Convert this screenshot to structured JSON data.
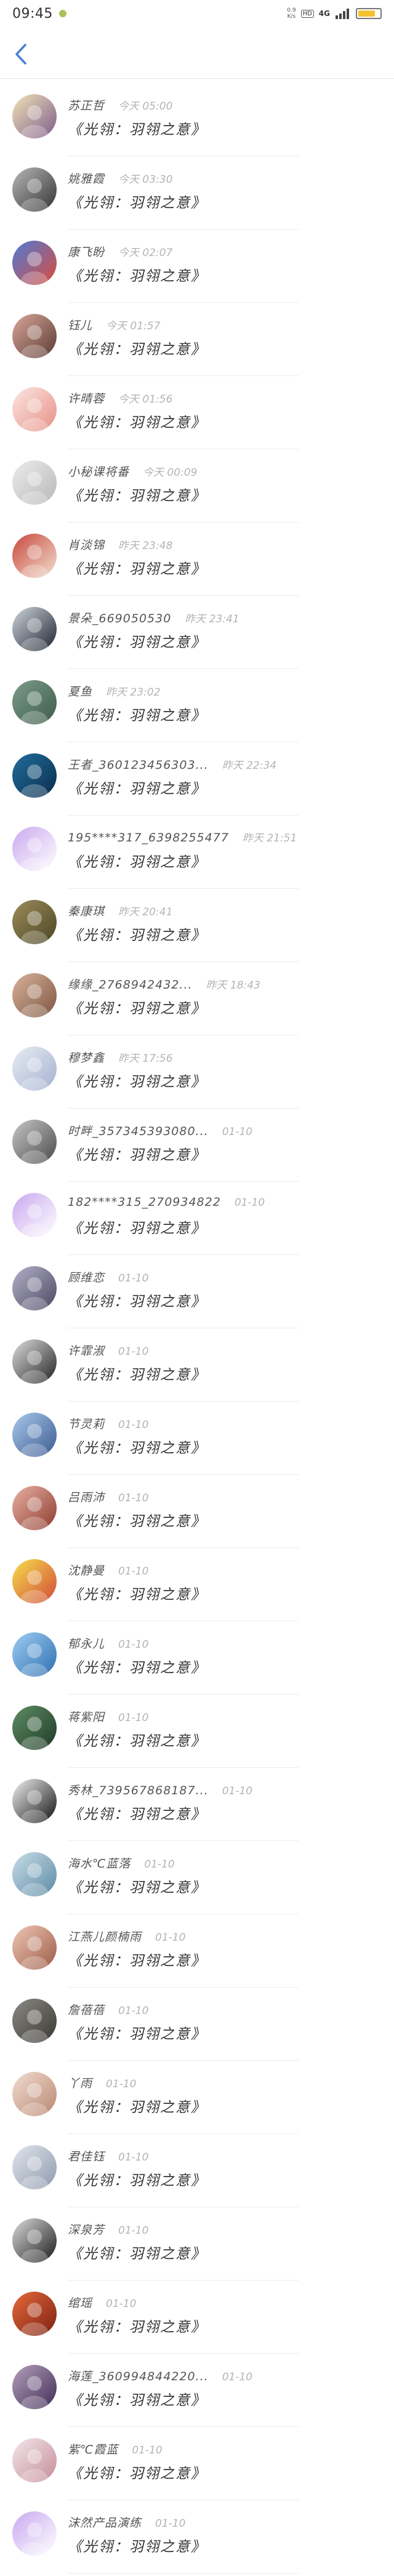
{
  "status_bar": {
    "time": "09:45",
    "net_speed_top": "0.9",
    "net_speed_unit": "K/s",
    "hd": "HD",
    "signal_label": "4G",
    "battery_color": "#f2c230",
    "battery_percent": 80
  },
  "header": {
    "back_icon": "chevron-left-icon",
    "accent": "#4a7fd4"
  },
  "conversations": [
    {
      "name": "苏正哲",
      "time": "今天 05:00",
      "message": "《光翎：羽翎之意》",
      "avatar": [
        "#f3e4b5",
        "#7d5a8c"
      ]
    },
    {
      "name": "姚雅霞",
      "time": "今天 03:30",
      "message": "《光翎：羽翎之意》",
      "avatar": [
        "#b8b8b8",
        "#333333"
      ]
    },
    {
      "name": "康飞盼",
      "time": "今天 02:07",
      "message": "《光翎：羽翎之意》",
      "avatar": [
        "#4f7bd6",
        "#d94c3c"
      ]
    },
    {
      "name": "钰儿",
      "time": "今天 01:57",
      "message": "《光翎：羽翎之意》",
      "avatar": [
        "#d9a79a",
        "#5a3a32"
      ]
    },
    {
      "name": "许晴蓉",
      "time": "今天 01:56",
      "message": "《光翎：羽翎之意》",
      "avatar": [
        "#fbe7e2",
        "#e78f86"
      ]
    },
    {
      "name": "小秘课将番",
      "time": "今天 00:09",
      "message": "《光翎：羽翎之意》",
      "avatar": [
        "#ececec",
        "#b8b8b8"
      ]
    },
    {
      "name": "肖淡锦",
      "time": "昨天 23:48",
      "message": "《光翎：羽翎之意》",
      "avatar": [
        "#c9473d",
        "#f1e0cf"
      ]
    },
    {
      "name": "景朵_669050530",
      "time": "昨天 23:41",
      "message": "《光翎：羽翎之意》",
      "avatar": [
        "#cfd6dd",
        "#1d2430"
      ]
    },
    {
      "name": "夏鱼",
      "time": "昨天 23:02",
      "message": "《光翎：羽翎之意》",
      "avatar": [
        "#7e9c8a",
        "#3c5b4a"
      ]
    },
    {
      "name": "王者_360123456303...",
      "time": "昨天 22:34",
      "message": "《光翎：羽翎之意》",
      "avatar": [
        "#1f6e9c",
        "#0c2c4d"
      ]
    },
    {
      "name": "195****317_6398255477",
      "time": "昨天 21:51",
      "message": "《光翎：羽翎之意》",
      "avatar": [
        "#c9a8ef",
        "#ffffff"
      ]
    },
    {
      "name": "秦康琪",
      "time": "昨天 20:41",
      "message": "《光翎：羽翎之意》",
      "avatar": [
        "#9b8d5a",
        "#4d4525"
      ]
    },
    {
      "name": "缘缘_2768942432...",
      "time": "昨天 18:43",
      "message": "《光翎：羽翎之意》",
      "avatar": [
        "#d9b49b",
        "#7d5442"
      ]
    },
    {
      "name": "穆梦鑫",
      "time": "昨天 17:56",
      "message": "《光翎：羽翎之意》",
      "avatar": [
        "#e8ecf4",
        "#a4b1cf"
      ]
    },
    {
      "name": "时畔_357345393080...",
      "time": "01-10",
      "message": "《光翎：羽翎之意》",
      "avatar": [
        "#c7c7c7",
        "#4a4a4a"
      ]
    },
    {
      "name": "182****315_270934822",
      "time": "01-10",
      "message": "《光翎：羽翎之意》",
      "avatar": [
        "#c9a8ef",
        "#ffffff"
      ]
    },
    {
      "name": "顾维恋",
      "time": "01-10",
      "message": "《光翎：羽翎之意》",
      "avatar": [
        "#b4b2c9",
        "#4b4762"
      ]
    },
    {
      "name": "许霏淑",
      "time": "01-10",
      "message": "《光翎：羽翎之意》",
      "avatar": [
        "#dedede",
        "#222222"
      ]
    },
    {
      "name": "节灵莉",
      "time": "01-10",
      "message": "《光翎：羽翎之意》",
      "avatar": [
        "#a9c8ec",
        "#3b5b8f"
      ]
    },
    {
      "name": "吕雨沛",
      "time": "01-10",
      "message": "《光翎：羽翎之意》",
      "avatar": [
        "#e9b2a5",
        "#8c3a2d"
      ]
    },
    {
      "name": "沈静曼",
      "time": "01-10",
      "message": "《光翎：羽翎之意》",
      "avatar": [
        "#f7de4a",
        "#d04a3a"
      ]
    },
    {
      "name": "郁永儿",
      "time": "01-10",
      "message": "《光翎：羽翎之意》",
      "avatar": [
        "#9fcdf0",
        "#2d70b3"
      ]
    },
    {
      "name": "蒋紫阳",
      "time": "01-10",
      "message": "《光翎：羽翎之意》",
      "avatar": [
        "#5f8d66",
        "#1f3a25"
      ]
    },
    {
      "name": "秀林_739567868187...",
      "time": "01-10",
      "message": "《光翎：羽翎之意》",
      "avatar": [
        "#f2f2f2",
        "#111111"
      ]
    },
    {
      "name": "海水℃蓝落",
      "time": "01-10",
      "message": "《光翎：羽翎之意》",
      "avatar": [
        "#c8dde9",
        "#5c8aa3"
      ]
    },
    {
      "name": "江燕儿颜楠雨",
      "time": "01-10",
      "message": "《光翎：羽翎之意》",
      "avatar": [
        "#f0c8b7",
        "#9b5a45"
      ]
    },
    {
      "name": "詹蓓蓓",
      "time": "01-10",
      "message": "《光翎：羽翎之意》",
      "avatar": [
        "#8c8a84",
        "#3a3833"
      ]
    },
    {
      "name": "丫雨",
      "time": "01-10",
      "message": "《光翎：羽翎之意》",
      "avatar": [
        "#f1ddd2",
        "#b9866f"
      ]
    },
    {
      "name": "君佳钰",
      "time": "01-10",
      "message": "《光翎：羽翎之意》",
      "avatar": [
        "#e1e5ec",
        "#8f9aad"
      ]
    },
    {
      "name": "深泉芳",
      "time": "01-10",
      "message": "《光翎：羽翎之意》",
      "avatar": [
        "#dcdcdc",
        "#1a1a1a"
      ]
    },
    {
      "name": "绾瑶",
      "time": "01-10",
      "message": "《光翎：羽翎之意》",
      "avatar": [
        "#e46a3c",
        "#7e1f10"
      ]
    },
    {
      "name": "海莲_360994844220...",
      "time": "01-10",
      "message": "《光翎：羽翎之意》",
      "avatar": [
        "#b5a0bb",
        "#3f2d56"
      ]
    },
    {
      "name": "紫℃霞蓝",
      "time": "01-10",
      "message": "《光翎：羽翎之意》",
      "avatar": [
        "#f2e7ea",
        "#c58c9a"
      ]
    },
    {
      "name": "沫然产品演练",
      "time": "01-10",
      "message": "《光翎：羽翎之意》",
      "avatar": [
        "#c9a8ef",
        "#ffffff"
      ]
    }
  ]
}
